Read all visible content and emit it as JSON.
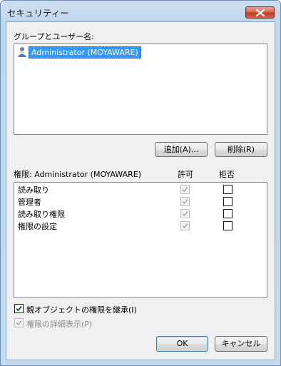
{
  "window": {
    "title": "セキュリティー",
    "close_label": "close"
  },
  "groups": {
    "label": "グループとユーザー名:",
    "items": [
      {
        "name": "Administrator (MOYAWARE)",
        "icon": "user-icon",
        "selected": true
      }
    ],
    "add_button": "追加(A)...",
    "remove_button": "削除(R)"
  },
  "permissions": {
    "header_label": "権限: Administrator (MOYAWARE)",
    "allow_header": "許可",
    "deny_header": "拒否",
    "rows": [
      {
        "name": "読み取り",
        "allow": true,
        "allow_enabled": false,
        "deny": false
      },
      {
        "name": "管理者",
        "allow": true,
        "allow_enabled": false,
        "deny": false
      },
      {
        "name": "読み取り権限",
        "allow": true,
        "allow_enabled": false,
        "deny": false
      },
      {
        "name": "権限の設定",
        "allow": true,
        "allow_enabled": false,
        "deny": false
      }
    ]
  },
  "options": {
    "inherit_label": "親オブジェクトの権限を継承(I)",
    "inherit_checked": true,
    "details_label": "権限の詳細表示(P)",
    "details_checked": true,
    "details_enabled": false
  },
  "footer": {
    "ok_button": "OK",
    "cancel_button": "キャンセル"
  },
  "colors": {
    "selection": "#3399ff",
    "close_button": "#c5371d",
    "frame": "#bfd6ee"
  }
}
